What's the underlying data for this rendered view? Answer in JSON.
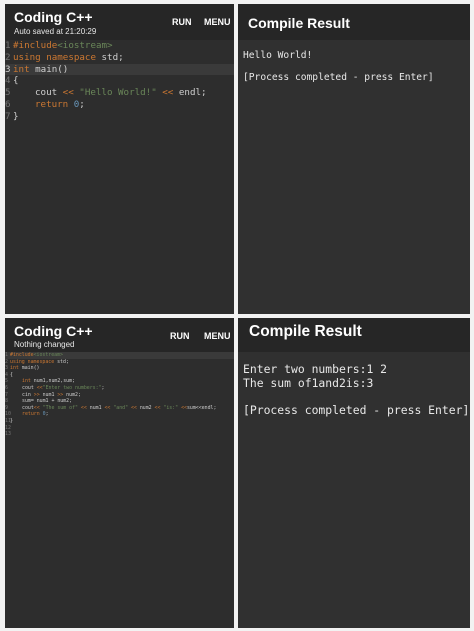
{
  "top": {
    "editor": {
      "title": "Coding C++",
      "subtitle": "Auto saved at 21:20:29",
      "run_label": "RUN",
      "menu_label": "MENU",
      "line_numbers": [
        "1",
        "2",
        "3",
        "4",
        "5",
        "6",
        "7"
      ],
      "code": {
        "l1_directive": "#include",
        "l1_header": "<iostream>",
        "l2_kw": "using namespace",
        "l2_rest": " std;",
        "l3_kw": "int",
        "l3_rest": " main()",
        "l4": "{",
        "l5_a": "cout ",
        "l5_op1": "<<",
        "l5_str": " \"Hello World!\" ",
        "l5_op2": "<<",
        "l5_b": " endl;",
        "l6_kw": "return",
        "l6_num": " 0",
        "l6_end": ";",
        "l7": "}"
      }
    },
    "result": {
      "title": "Compile Result",
      "output_line1": "Hello World!",
      "output_line2": "",
      "output_line3": "[Process completed - press Enter]"
    }
  },
  "bottom": {
    "editor": {
      "title": "Coding C++",
      "subtitle": "Nothing changed",
      "run_label": "RUN",
      "menu_label": "MENU",
      "line_numbers": [
        "1",
        "2",
        "3",
        "4",
        "5",
        "6",
        "7",
        "8",
        "9",
        "10",
        "11",
        "12",
        "13"
      ],
      "code": {
        "l1_directive": "#include",
        "l1_header": "<iostream>",
        "l2_kw": "using namespace",
        "l2_rest": " std;",
        "l3_kw": "int",
        "l3_rest": " main()",
        "l4": "{",
        "l5_kw": "int",
        "l5_rest": " num1,num2,sum;",
        "l6_a": "cout ",
        "l6_op": "<<",
        "l6_str": "\"Enter two numbers:\"",
        "l6_end": ";",
        "l7_a": "cin ",
        "l7_op": ">>",
        "l7_b": " num1 ",
        "l7_op2": ">>",
        "l7_c": " num2;",
        "l8": "sum= num1 + num2;",
        "l9_a": "cout",
        "l9_op1": "<< ",
        "l9_s1": "\"The sum of\"",
        "l9_op2": " << ",
        "l9_b": "num1",
        "l9_op3": " << ",
        "l9_s2": "\"and\"",
        "l9_op4": " << ",
        "l9_c": "num2",
        "l9_op5": " << ",
        "l9_s3": "\"is:\"",
        "l9_op6": " <<",
        "l9_d": "sum<<endl;",
        "l10_kw": "return",
        "l10_num": " 0",
        "l10_end": ";",
        "l11": "}"
      }
    },
    "result": {
      "title": "Compile Result",
      "output_line1": "Enter two numbers:1 2",
      "output_line2": "The sum of1and2is:3",
      "output_line3": "",
      "output_line4": "[Process completed - press Enter]"
    }
  },
  "colors": {
    "header_bg": "#262626",
    "editor_bg": "#2d2d2d",
    "keyword": "#cc7832",
    "string": "#6a8759",
    "number": "#6897bb",
    "line_number": "#727272"
  }
}
